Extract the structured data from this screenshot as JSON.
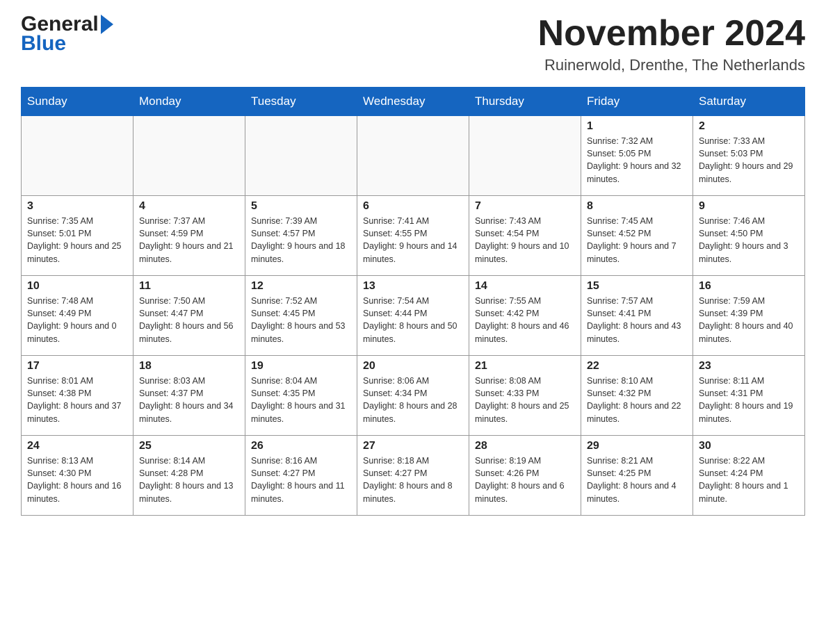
{
  "header": {
    "logo_general": "General",
    "logo_blue": "Blue",
    "month_title": "November 2024",
    "location": "Ruinerwold, Drenthe, The Netherlands"
  },
  "weekdays": [
    "Sunday",
    "Monday",
    "Tuesday",
    "Wednesday",
    "Thursday",
    "Friday",
    "Saturday"
  ],
  "weeks": [
    [
      {
        "day": "",
        "sunrise": "",
        "sunset": "",
        "daylight": ""
      },
      {
        "day": "",
        "sunrise": "",
        "sunset": "",
        "daylight": ""
      },
      {
        "day": "",
        "sunrise": "",
        "sunset": "",
        "daylight": ""
      },
      {
        "day": "",
        "sunrise": "",
        "sunset": "",
        "daylight": ""
      },
      {
        "day": "",
        "sunrise": "",
        "sunset": "",
        "daylight": ""
      },
      {
        "day": "1",
        "sunrise": "Sunrise: 7:32 AM",
        "sunset": "Sunset: 5:05 PM",
        "daylight": "Daylight: 9 hours and 32 minutes."
      },
      {
        "day": "2",
        "sunrise": "Sunrise: 7:33 AM",
        "sunset": "Sunset: 5:03 PM",
        "daylight": "Daylight: 9 hours and 29 minutes."
      }
    ],
    [
      {
        "day": "3",
        "sunrise": "Sunrise: 7:35 AM",
        "sunset": "Sunset: 5:01 PM",
        "daylight": "Daylight: 9 hours and 25 minutes."
      },
      {
        "day": "4",
        "sunrise": "Sunrise: 7:37 AM",
        "sunset": "Sunset: 4:59 PM",
        "daylight": "Daylight: 9 hours and 21 minutes."
      },
      {
        "day": "5",
        "sunrise": "Sunrise: 7:39 AM",
        "sunset": "Sunset: 4:57 PM",
        "daylight": "Daylight: 9 hours and 18 minutes."
      },
      {
        "day": "6",
        "sunrise": "Sunrise: 7:41 AM",
        "sunset": "Sunset: 4:55 PM",
        "daylight": "Daylight: 9 hours and 14 minutes."
      },
      {
        "day": "7",
        "sunrise": "Sunrise: 7:43 AM",
        "sunset": "Sunset: 4:54 PM",
        "daylight": "Daylight: 9 hours and 10 minutes."
      },
      {
        "day": "8",
        "sunrise": "Sunrise: 7:45 AM",
        "sunset": "Sunset: 4:52 PM",
        "daylight": "Daylight: 9 hours and 7 minutes."
      },
      {
        "day": "9",
        "sunrise": "Sunrise: 7:46 AM",
        "sunset": "Sunset: 4:50 PM",
        "daylight": "Daylight: 9 hours and 3 minutes."
      }
    ],
    [
      {
        "day": "10",
        "sunrise": "Sunrise: 7:48 AM",
        "sunset": "Sunset: 4:49 PM",
        "daylight": "Daylight: 9 hours and 0 minutes."
      },
      {
        "day": "11",
        "sunrise": "Sunrise: 7:50 AM",
        "sunset": "Sunset: 4:47 PM",
        "daylight": "Daylight: 8 hours and 56 minutes."
      },
      {
        "day": "12",
        "sunrise": "Sunrise: 7:52 AM",
        "sunset": "Sunset: 4:45 PM",
        "daylight": "Daylight: 8 hours and 53 minutes."
      },
      {
        "day": "13",
        "sunrise": "Sunrise: 7:54 AM",
        "sunset": "Sunset: 4:44 PM",
        "daylight": "Daylight: 8 hours and 50 minutes."
      },
      {
        "day": "14",
        "sunrise": "Sunrise: 7:55 AM",
        "sunset": "Sunset: 4:42 PM",
        "daylight": "Daylight: 8 hours and 46 minutes."
      },
      {
        "day": "15",
        "sunrise": "Sunrise: 7:57 AM",
        "sunset": "Sunset: 4:41 PM",
        "daylight": "Daylight: 8 hours and 43 minutes."
      },
      {
        "day": "16",
        "sunrise": "Sunrise: 7:59 AM",
        "sunset": "Sunset: 4:39 PM",
        "daylight": "Daylight: 8 hours and 40 minutes."
      }
    ],
    [
      {
        "day": "17",
        "sunrise": "Sunrise: 8:01 AM",
        "sunset": "Sunset: 4:38 PM",
        "daylight": "Daylight: 8 hours and 37 minutes."
      },
      {
        "day": "18",
        "sunrise": "Sunrise: 8:03 AM",
        "sunset": "Sunset: 4:37 PM",
        "daylight": "Daylight: 8 hours and 34 minutes."
      },
      {
        "day": "19",
        "sunrise": "Sunrise: 8:04 AM",
        "sunset": "Sunset: 4:35 PM",
        "daylight": "Daylight: 8 hours and 31 minutes."
      },
      {
        "day": "20",
        "sunrise": "Sunrise: 8:06 AM",
        "sunset": "Sunset: 4:34 PM",
        "daylight": "Daylight: 8 hours and 28 minutes."
      },
      {
        "day": "21",
        "sunrise": "Sunrise: 8:08 AM",
        "sunset": "Sunset: 4:33 PM",
        "daylight": "Daylight: 8 hours and 25 minutes."
      },
      {
        "day": "22",
        "sunrise": "Sunrise: 8:10 AM",
        "sunset": "Sunset: 4:32 PM",
        "daylight": "Daylight: 8 hours and 22 minutes."
      },
      {
        "day": "23",
        "sunrise": "Sunrise: 8:11 AM",
        "sunset": "Sunset: 4:31 PM",
        "daylight": "Daylight: 8 hours and 19 minutes."
      }
    ],
    [
      {
        "day": "24",
        "sunrise": "Sunrise: 8:13 AM",
        "sunset": "Sunset: 4:30 PM",
        "daylight": "Daylight: 8 hours and 16 minutes."
      },
      {
        "day": "25",
        "sunrise": "Sunrise: 8:14 AM",
        "sunset": "Sunset: 4:28 PM",
        "daylight": "Daylight: 8 hours and 13 minutes."
      },
      {
        "day": "26",
        "sunrise": "Sunrise: 8:16 AM",
        "sunset": "Sunset: 4:27 PM",
        "daylight": "Daylight: 8 hours and 11 minutes."
      },
      {
        "day": "27",
        "sunrise": "Sunrise: 8:18 AM",
        "sunset": "Sunset: 4:27 PM",
        "daylight": "Daylight: 8 hours and 8 minutes."
      },
      {
        "day": "28",
        "sunrise": "Sunrise: 8:19 AM",
        "sunset": "Sunset: 4:26 PM",
        "daylight": "Daylight: 8 hours and 6 minutes."
      },
      {
        "day": "29",
        "sunrise": "Sunrise: 8:21 AM",
        "sunset": "Sunset: 4:25 PM",
        "daylight": "Daylight: 8 hours and 4 minutes."
      },
      {
        "day": "30",
        "sunrise": "Sunrise: 8:22 AM",
        "sunset": "Sunset: 4:24 PM",
        "daylight": "Daylight: 8 hours and 1 minute."
      }
    ]
  ]
}
